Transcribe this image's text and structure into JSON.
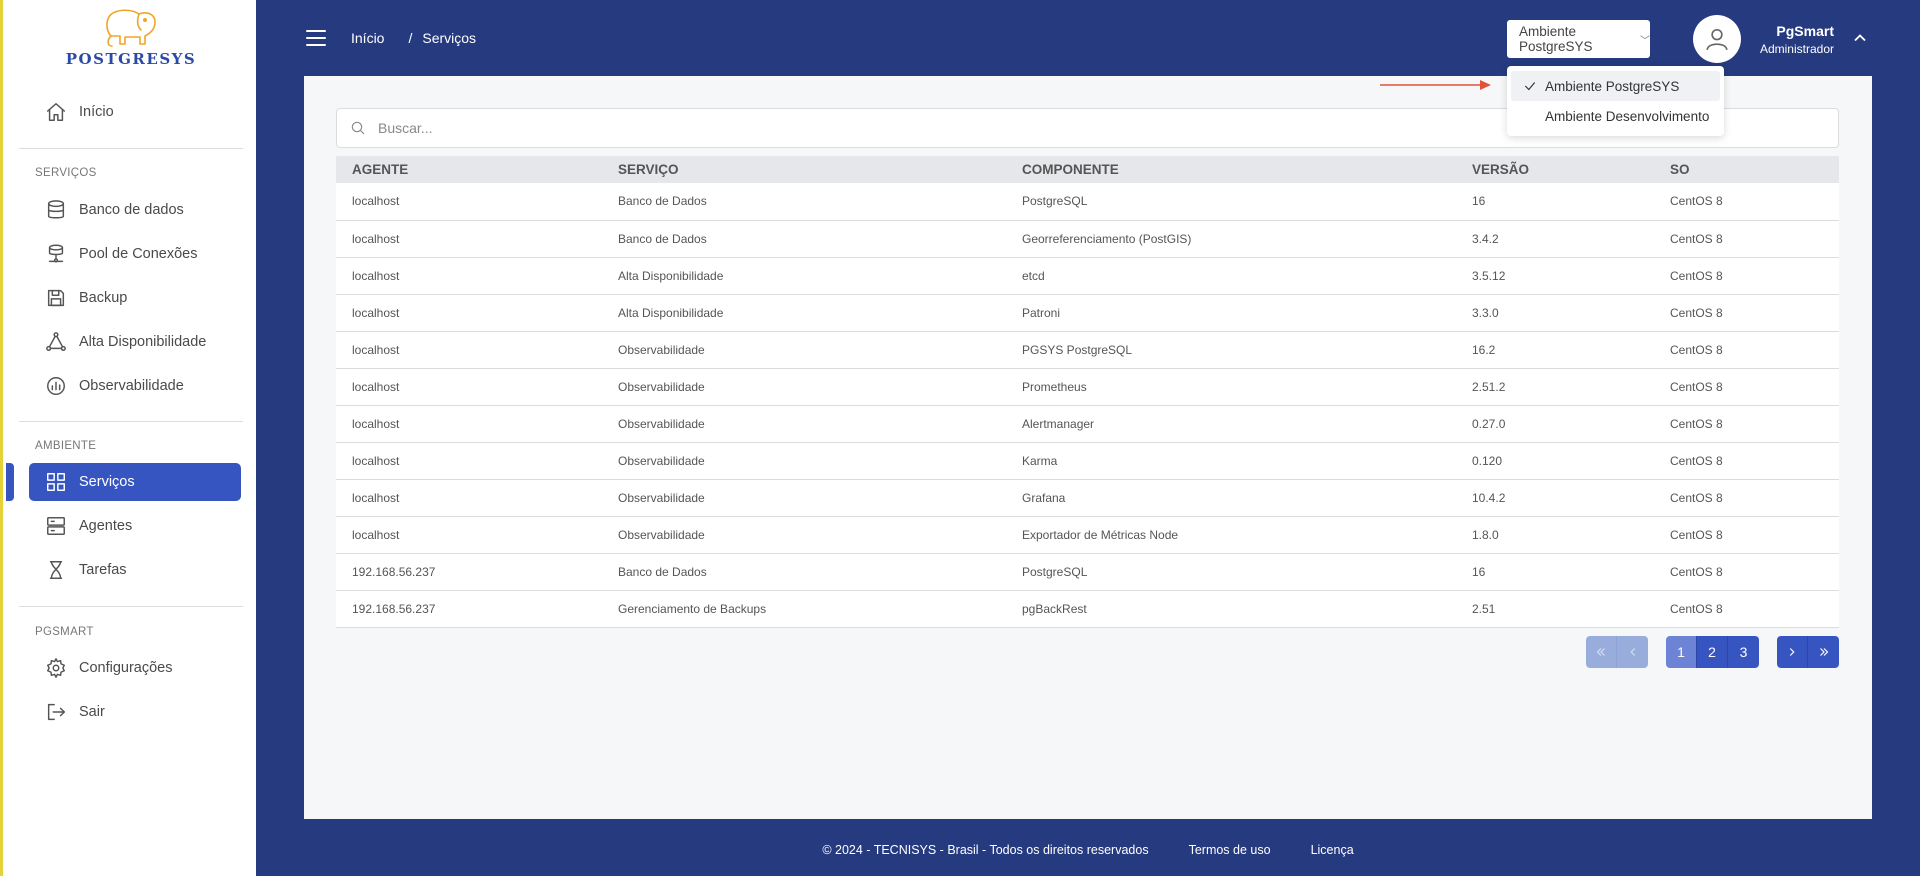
{
  "brand": {
    "name": "POSTGRESYS",
    "logo_icon": "elephant-logo",
    "accent": "#f0a52a",
    "primary": "#3655c0",
    "header_bg": "#263a7f"
  },
  "sidebar": {
    "home": {
      "label": "Início",
      "icon": "home-icon"
    },
    "sections": {
      "servicos": "SERVIÇOS",
      "ambiente": "AMBIENTE",
      "pgsmart": "PGSMART"
    },
    "servicos_items": [
      {
        "label": "Banco de dados",
        "icon": "database-icon"
      },
      {
        "label": "Pool de Conexões",
        "icon": "pool-icon"
      },
      {
        "label": "Backup",
        "icon": "save-icon"
      },
      {
        "label": "Alta Disponibilidade",
        "icon": "network-icon"
      },
      {
        "label": "Observabilidade",
        "icon": "chart-icon"
      }
    ],
    "ambiente_items": [
      {
        "label": "Serviços",
        "icon": "grid-icon"
      },
      {
        "label": "Agentes",
        "icon": "server-icon"
      },
      {
        "label": "Tarefas",
        "icon": "hourglass-icon"
      }
    ],
    "pgsmart_items": [
      {
        "label": "Configurações",
        "icon": "gear-icon"
      },
      {
        "label": "Sair",
        "icon": "logout-icon"
      }
    ]
  },
  "header": {
    "breadcrumb": {
      "home": "Início",
      "separator": "/",
      "current": "Serviços"
    },
    "environment_select": {
      "value": "Ambiente PostgreSYS"
    },
    "user": {
      "name": "PgSmart",
      "role": "Administrador"
    }
  },
  "environment_dropdown": {
    "options": [
      "Ambiente PostgreSYS",
      "Ambiente Desenvolvimento"
    ],
    "selected": "Ambiente PostgreSYS"
  },
  "search": {
    "placeholder": "Buscar...",
    "value": ""
  },
  "table": {
    "columns": [
      "AGENTE",
      "SERVIÇO",
      "COMPONENTE",
      "VERSÃO",
      "SO"
    ],
    "rows": [
      [
        "localhost",
        "Banco de Dados",
        "PostgreSQL",
        "16",
        "CentOS 8"
      ],
      [
        "localhost",
        "Banco de Dados",
        "Georreferenciamento (PostGIS)",
        "3.4.2",
        "CentOS 8"
      ],
      [
        "localhost",
        "Alta Disponibilidade",
        "etcd",
        "3.5.12",
        "CentOS 8"
      ],
      [
        "localhost",
        "Alta Disponibilidade",
        "Patroni",
        "3.3.0",
        "CentOS 8"
      ],
      [
        "localhost",
        "Observabilidade",
        "PGSYS PostgreSQL",
        "16.2",
        "CentOS 8"
      ],
      [
        "localhost",
        "Observabilidade",
        "Prometheus",
        "2.51.2",
        "CentOS 8"
      ],
      [
        "localhost",
        "Observabilidade",
        "Alertmanager",
        "0.27.0",
        "CentOS 8"
      ],
      [
        "localhost",
        "Observabilidade",
        "Karma",
        "0.120",
        "CentOS 8"
      ],
      [
        "localhost",
        "Observabilidade",
        "Grafana",
        "10.4.2",
        "CentOS 8"
      ],
      [
        "localhost",
        "Observabilidade",
        "Exportador de Métricas Node",
        "1.8.0",
        "CentOS 8"
      ],
      [
        "192.168.56.237",
        "Banco de Dados",
        "PostgreSQL",
        "16",
        "CentOS 8"
      ],
      [
        "192.168.56.237",
        "Gerenciamento de Backups",
        "pgBackRest",
        "2.51",
        "CentOS 8"
      ]
    ]
  },
  "pagination": {
    "pages": [
      "1",
      "2",
      "3"
    ],
    "current": "1"
  },
  "footer": {
    "copyright": "© 2024 - TECNISYS - Brasil - Todos os direitos reservados",
    "terms": "Termos de uso",
    "license": "Licença"
  }
}
